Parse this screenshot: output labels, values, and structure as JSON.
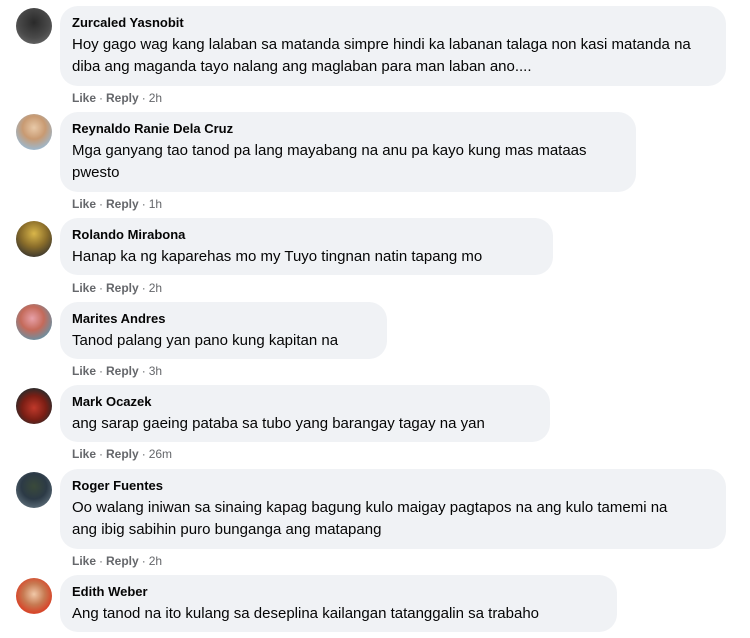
{
  "comments": [
    {
      "author": "Zurcaled Yasnobit",
      "text": "Hoy gago wag kang lalaban sa matanda simpre hindi ka labanan talaga non kasi matanda na diba ang maganda tayo nalang ang maglaban para man laban ano....",
      "like": "Like",
      "reply": "Reply",
      "time": "2h"
    },
    {
      "author": "Reynaldo Ranie Dela Cruz",
      "text": "Mga ganyang tao tanod pa lang mayabang na anu pa kayo kung mas mataas pwesto",
      "like": "Like",
      "reply": "Reply",
      "time": "1h"
    },
    {
      "author": "Rolando Mirabona",
      "text": "Hanap ka ng kaparehas mo my Tuyo tingnan natin tapang mo",
      "like": "Like",
      "reply": "Reply",
      "time": "2h"
    },
    {
      "author": "Marites Andres",
      "text": "Tanod palang yan pano kung kapitan na",
      "like": "Like",
      "reply": "Reply",
      "time": "3h"
    },
    {
      "author": "Mark Ocazek",
      "text": "ang sarap gaeing pataba sa tubo yang barangay tagay na yan",
      "like": "Like",
      "reply": "Reply",
      "time": "26m"
    },
    {
      "author": "Roger Fuentes",
      "text": "Oo walang iniwan sa sinaing kapag bagung kulo maigay pagtapos na ang kulo tamemi na ang ibig sabihin puro bunganga ang matapang",
      "like": "Like",
      "reply": "Reply",
      "time": "2h"
    },
    {
      "author": "Edith Weber",
      "text": "Ang tanod na ito kulang sa deseplina kailangan tatanggalin sa trabaho"
    }
  ],
  "colors": {
    "bubble": "#f0f2f5",
    "meta": "#65676b",
    "text": "#050505"
  }
}
